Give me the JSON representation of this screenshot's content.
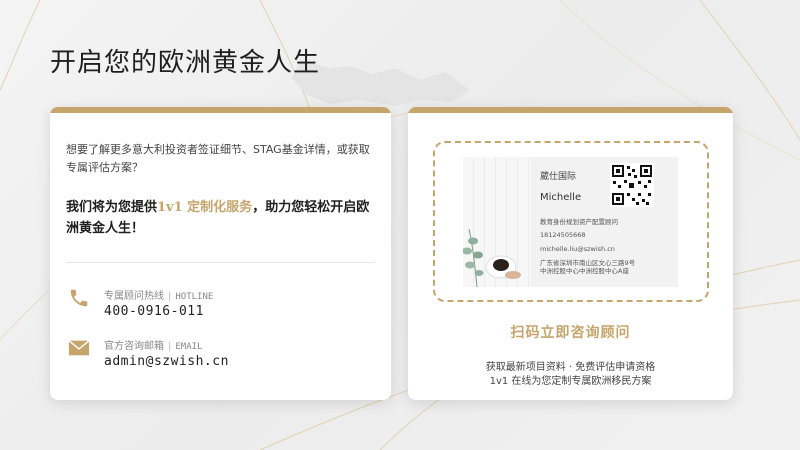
{
  "page": {
    "title": "开启您的欧洲黄金人生"
  },
  "left_card": {
    "intro": "想要了解更多意大利投资者签证细节、STAG基金详情，或获取专属评估方案？",
    "offer_prefix": "我们将为您提供",
    "offer_highlight": "1v1 定制化服务",
    "offer_suffix": "，助力您轻松开启欧洲黄金人生！",
    "hotline": {
      "label_cn": "专属顾问热线",
      "label_sep": "|",
      "label_en": "HOTLINE",
      "value": "400-0916-011",
      "icon": "phone-icon"
    },
    "email": {
      "label_cn": "官方咨询邮箱",
      "label_sep": "|",
      "label_en": "EMAIL",
      "value": "admin@szwish.cn",
      "icon": "envelope-icon"
    }
  },
  "right_card": {
    "business_card": {
      "company": "葳仕国际",
      "name": "Michelle",
      "role": "教育身份规划资产配置顾问",
      "phone": "18124505668",
      "email": "michelle.liu@szwish.cn",
      "address_line1": "广东省深圳市南山区文心三路9号",
      "address_line2": "中洲控股中心中洲控股中心A座"
    },
    "scan_title": "扫码立即咨询顾问",
    "subtitle_line1": "获取最新项目资料 · 免费评估申请资格",
    "subtitle_line2": "1v1 在线为您定制专属欧洲移民方案"
  },
  "colors": {
    "accent_gold": "#c5a56c",
    "title_text": "#1f1f1f",
    "card_bg": "#ffffff"
  }
}
